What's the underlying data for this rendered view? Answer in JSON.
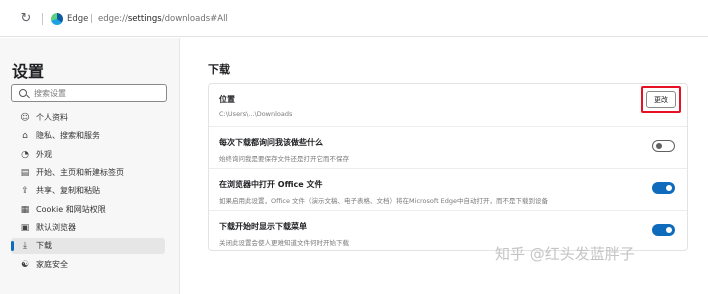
{
  "address_bar": {
    "browser_name": "Edge",
    "separator": "|",
    "url_scheme": "edge://",
    "url_bold": "settings",
    "url_rest": "/downloads#All"
  },
  "sidebar": {
    "title": "设置",
    "search_placeholder": "搜索设置",
    "items": [
      {
        "icon": "profile-icon",
        "glyph": "☺",
        "label": "个人资料",
        "active": false
      },
      {
        "icon": "lock-icon",
        "glyph": "⌂",
        "label": "隐私、搜索和服务",
        "active": false
      },
      {
        "icon": "appearance-icon",
        "glyph": "◔",
        "label": "外观",
        "active": false
      },
      {
        "icon": "start-page-icon",
        "glyph": "▤",
        "label": "开始、主页和新建标签页",
        "active": false
      },
      {
        "icon": "share-icon",
        "glyph": "⇪",
        "label": "共享、复制和粘贴",
        "active": false
      },
      {
        "icon": "cookie-icon",
        "glyph": "▦",
        "label": "Cookie 和网站权限",
        "active": false
      },
      {
        "icon": "default-browser-icon",
        "glyph": "▣",
        "label": "默认浏览器",
        "active": false
      },
      {
        "icon": "download-icon",
        "glyph": "⤓",
        "label": "下载",
        "active": true
      },
      {
        "icon": "family-icon",
        "glyph": "☯",
        "label": "家庭安全",
        "active": false
      }
    ]
  },
  "main": {
    "title": "下载",
    "location": {
      "title": "位置",
      "path": "C:\\Users\\...\\Downloads",
      "change_label": "更改"
    },
    "ask_each_time": {
      "title": "每次下载都询问我该做些什么",
      "desc": "始终询问我是要保存文件还是打开它而不保存",
      "enabled": false
    },
    "open_office": {
      "title": "在浏览器中打开 Office 文件",
      "desc": "如果启用此设置，Office 文件（演示文稿、电子表格、文档）将在Microsoft Edge中自动打开，而不是下载到设备",
      "enabled": true
    },
    "show_menu": {
      "title": "下载开始时显示下载菜单",
      "desc": "关闭此设置会使人更难知道文件何时开始下载",
      "enabled": true
    }
  },
  "watermark": "知乎 @红头发蓝胖子",
  "colors": {
    "accent": "#0f6cbd",
    "highlight_border": "#e81123",
    "sidebar_bg": "#f7f7f7"
  }
}
